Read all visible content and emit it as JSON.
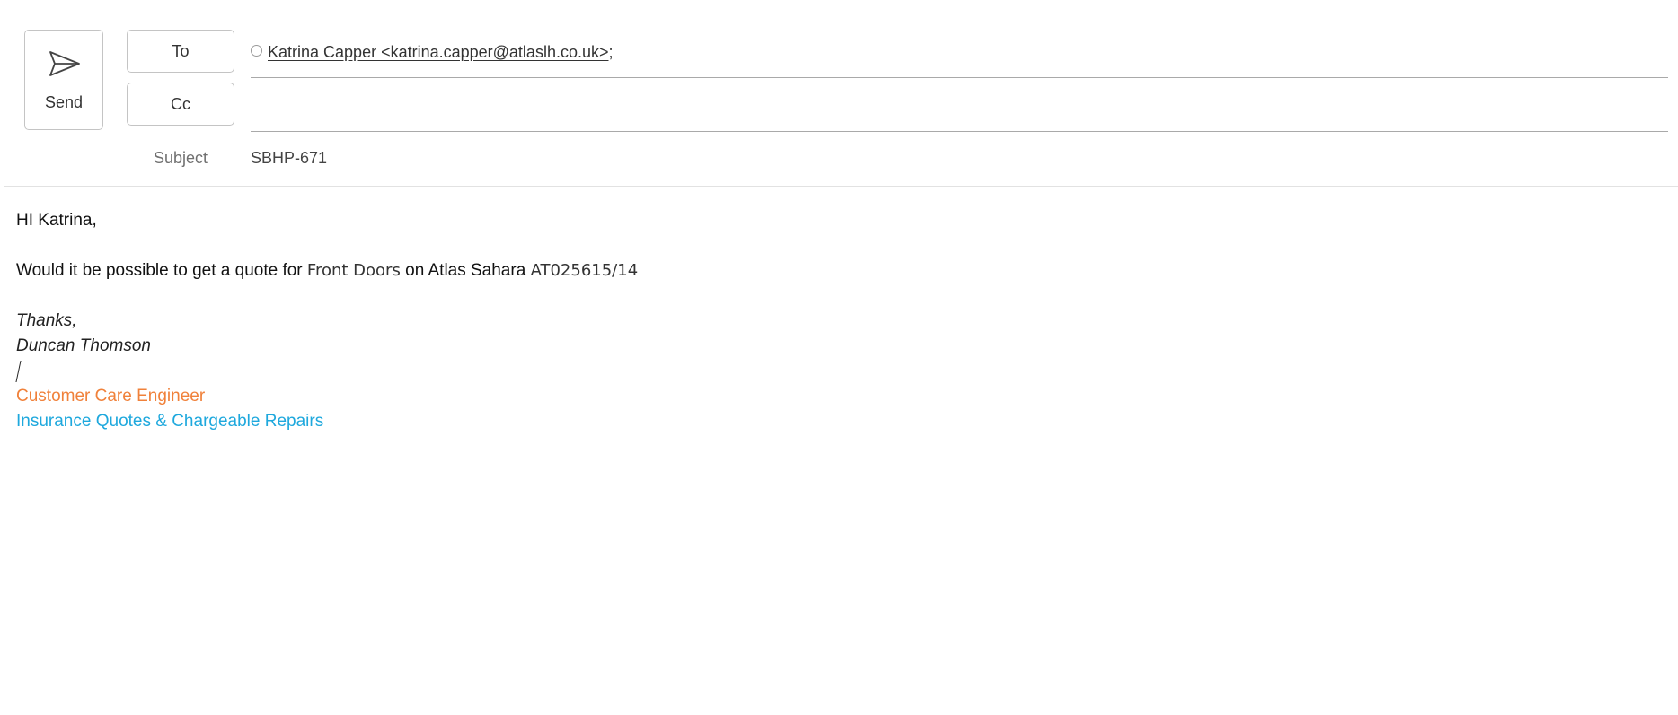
{
  "compose": {
    "send_label": "Send",
    "to_label": "To",
    "cc_label": "Cc",
    "subject_label": "Subject",
    "subject_value": "SBHP-671",
    "recipients": [
      {
        "display": "Katrina Capper <katrina.capper@atlaslh.co.uk>",
        "separator": ";"
      }
    ]
  },
  "body": {
    "greeting": "HI Katrina,",
    "request_prefix": "Would it be possible to get a quote for ",
    "request_item": "Front Doors",
    "request_middle": " on Atlas Sahara ",
    "request_ref": "AT025615/14",
    "signoff": "Thanks,",
    "sender_name": "Duncan Thomson",
    "sender_title": "Customer Care Engineer",
    "sender_department": "Insurance Quotes & Chargeable Repairs"
  },
  "colors": {
    "title_orange": "#f0813a",
    "department_blue": "#1ea8dd"
  },
  "icons": {
    "send": "paper-plane-icon",
    "presence": "presence-circle-icon"
  }
}
